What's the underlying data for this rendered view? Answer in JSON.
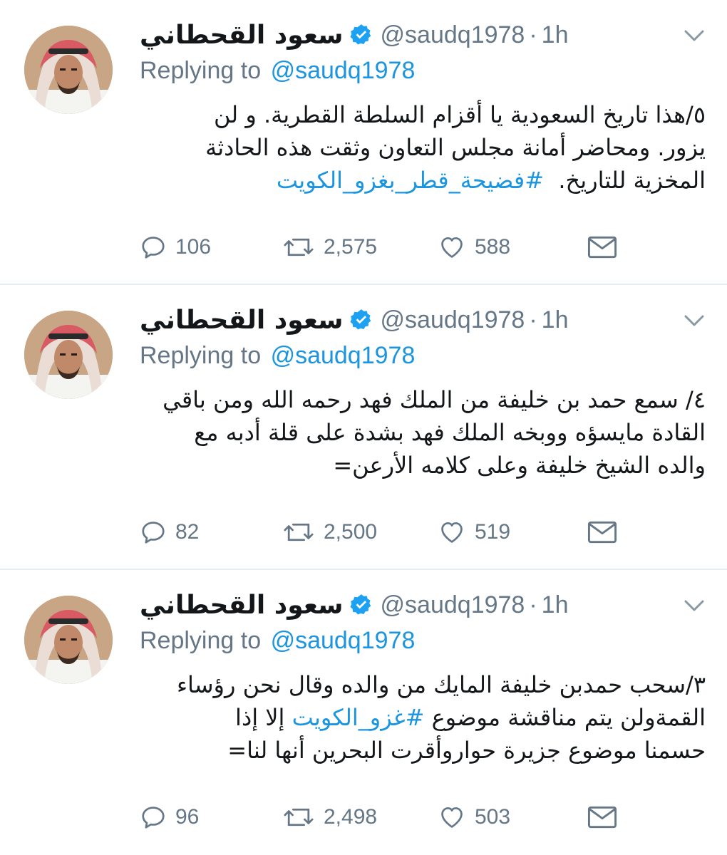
{
  "tweets": [
    {
      "author_name": "سعود القحطاني",
      "handle": "@saudq1978",
      "separator": "·",
      "time": "1h",
      "replying_label": "Replying to",
      "replying_handle": "@saudq1978",
      "lines": [
        "٥/هذا تاريخ السعودية يا أقزام السلطة القطرية. و لن",
        "يزور. ومحاضر أمانة مجلس التعاون وثقت هذه الحادثة"
      ],
      "last_line_text": "المخزية للتاريخ.",
      "last_line_hashtag": "#فضيحة_قطر_بغزو_الكويت",
      "replies": "106",
      "retweets": "2,575",
      "likes": "588"
    },
    {
      "author_name": "سعود القحطاني",
      "handle": "@saudq1978",
      "separator": "·",
      "time": "1h",
      "replying_label": "Replying to",
      "replying_handle": "@saudq1978",
      "lines": [
        "٤/ سمع حمد بن خليفة من الملك فهد رحمه الله ومن باقي",
        "القادة مايسؤه ووبخه الملك فهد بشدة على قلة أدبه مع",
        "والده الشيخ خليفة وعلى كلامه الأرعن="
      ],
      "replies": "82",
      "retweets": "2,500",
      "likes": "519"
    },
    {
      "author_name": "سعود القحطاني",
      "handle": "@saudq1978",
      "separator": "·",
      "time": "1h",
      "replying_label": "Replying to",
      "replying_handle": "@saudq1978",
      "line1": "٣/سحب حمدبن خليفة المايك من والده وقال نحن رؤساء",
      "line2_before": "القمةولن يتم مناقشة موضوع",
      "line2_hashtag": "#غزو_الكويت",
      "line2_after": "إلا إذا",
      "line3": "حسمنا موضوع جزيرة حواروأقرت البحرين أنها لنا=",
      "replies": "96",
      "retweets": "2,498",
      "likes": "503"
    }
  ],
  "colors": {
    "link_blue": "#1b95e0",
    "muted_gray": "#657786",
    "verified_blue": "#1da1f2",
    "divider": "#e6ecf0"
  },
  "icons": [
    "avatar",
    "verified-badge-icon",
    "chevron-down-icon",
    "reply-icon",
    "retweet-icon",
    "like-icon",
    "direct-message-icon"
  ]
}
